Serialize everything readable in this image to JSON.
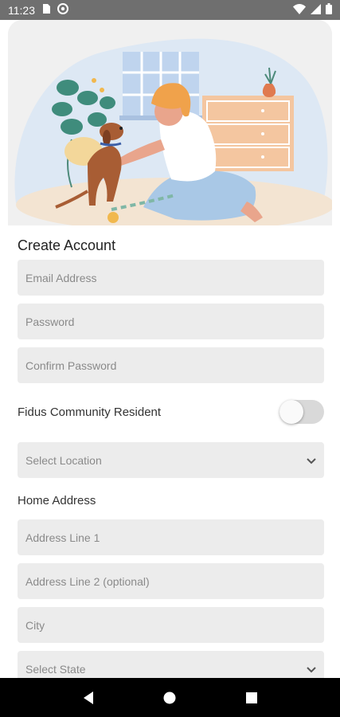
{
  "status_bar": {
    "time": "11:23",
    "icons": [
      "sim-icon",
      "at-sign-icon",
      "wifi-icon",
      "signal-icon",
      "battery-icon"
    ]
  },
  "form": {
    "title": "Create Account",
    "email_placeholder": "Email Address",
    "password_placeholder": "Password",
    "confirm_password_placeholder": "Confirm Password",
    "resident_toggle_label": "Fidus Community Resident",
    "resident_toggle_on": false,
    "location_placeholder": "Select Location",
    "home_address_heading": "Home Address",
    "address1_placeholder": "Address Line 1",
    "address2_placeholder": "Address Line 2 (optional)",
    "city_placeholder": "City",
    "state_placeholder": "Select State"
  },
  "nav_bar": {
    "buttons": [
      "back-icon",
      "home-icon",
      "recents-icon"
    ]
  },
  "colors": {
    "status_bar": "#6f6f6f",
    "field_bg": "#ececec",
    "nav_bar": "#000000"
  }
}
